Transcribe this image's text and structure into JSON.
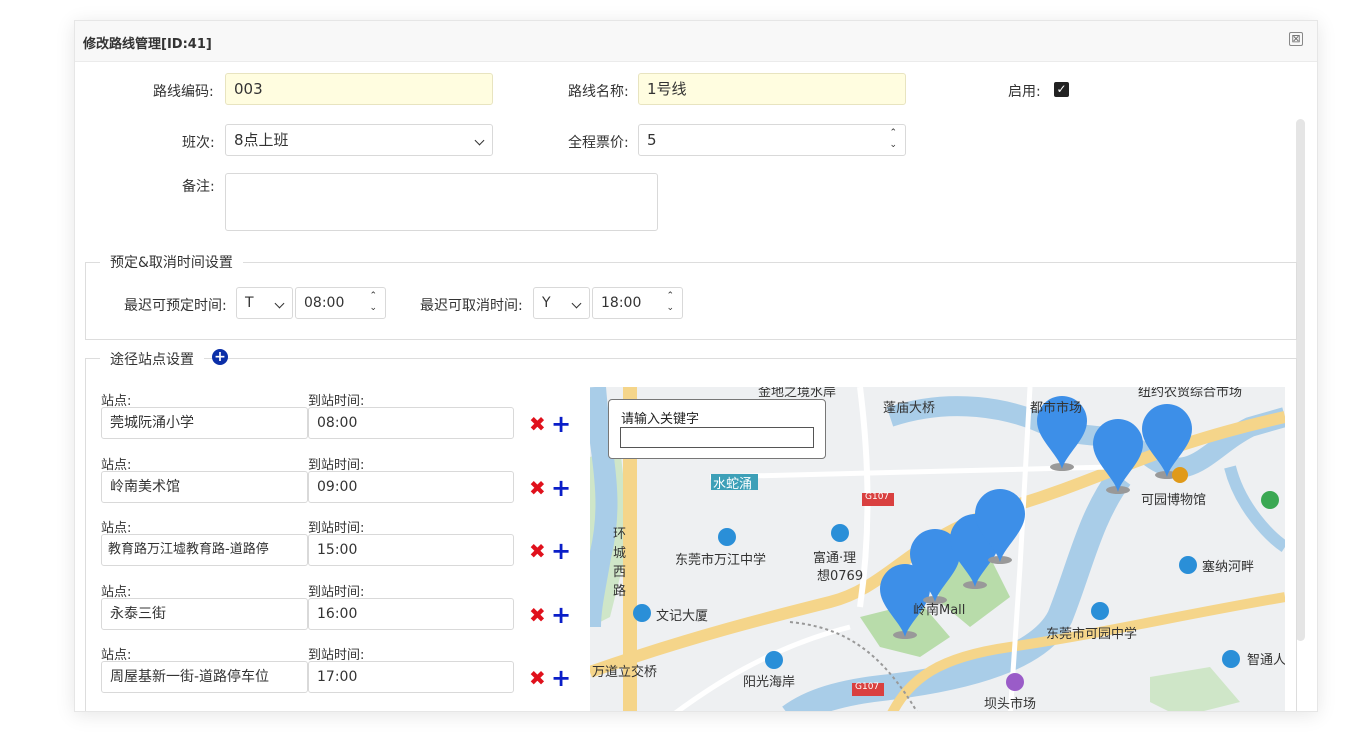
{
  "dialog": {
    "title": "修改路线管理[ID:41]",
    "close_icon": "⊠"
  },
  "form": {
    "code_label": "路线编码:",
    "code_value": "003",
    "name_label": "路线名称:",
    "name_value": "1号线",
    "enabled_label": "启用:",
    "enabled_checked": true,
    "shift_label": "班次:",
    "shift_value": "8点上班",
    "fare_label": "全程票价:",
    "fare_value": "5",
    "remark_label": "备注:",
    "remark_value": ""
  },
  "booking": {
    "legend": "预定&取消时间设置",
    "book_label": "最迟可预定时间:",
    "book_day": "T",
    "book_time": "08:00",
    "cancel_label": "最迟可取消时间:",
    "cancel_day": "Y",
    "cancel_time": "18:00"
  },
  "stops": {
    "legend": "途径站点设置",
    "station_label": "站点:",
    "time_label": "到站时间:",
    "items": [
      {
        "station": "莞城阮涌小学",
        "time": "08:00"
      },
      {
        "station": "岭南美术馆",
        "time": "09:00"
      },
      {
        "station": "教育路万江墟教育路-道路停",
        "time": "15:00"
      },
      {
        "station": "永泰三街",
        "time": "16:00"
      },
      {
        "station": "周屋基新一街-道路停车位",
        "time": "17:00"
      }
    ]
  },
  "map": {
    "search_label": "请输入关键字",
    "labels": {
      "l1": "金地之境水岸",
      "l2": "蓬庙大桥",
      "l3": "都市市场",
      "l4": "纽约农贸综合市场",
      "l5": "水蛇涌",
      "l6": "可园博物馆",
      "l7": "东莞市万江中学",
      "l8": "富通·理",
      "l9": "想0769",
      "l10": "环",
      "l11": "城",
      "l12": "西",
      "l13": "路",
      "l14": "塞纳河畔",
      "l15": "文记大厦",
      "l16": "岭南Mall",
      "l17": "东莞市可园中学",
      "l18": "万道立交桥",
      "l19": "阳光海岸",
      "l20": "智通人",
      "l21": "坝头市场",
      "g107a": "G107",
      "g107b": "G107"
    }
  }
}
